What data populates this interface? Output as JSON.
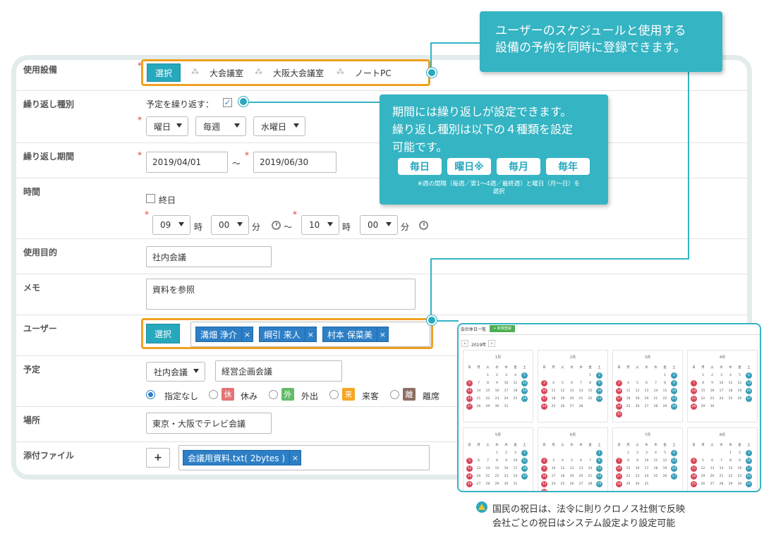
{
  "form": {
    "facility": {
      "label": "使用設備",
      "select_label": "選択",
      "items": [
        "大会議室",
        "大阪大会議室",
        "ノートPC"
      ]
    },
    "repeat_type": {
      "label": "繰り返し種別",
      "repeat_label": "予定を繰り返す：",
      "checked_mark": "✓",
      "selects": [
        "曜日",
        "毎週",
        "水曜日"
      ]
    },
    "repeat_period": {
      "label": "繰り返し期間",
      "start": "2019/04/01",
      "tilde": "～",
      "end": "2019/06/30"
    },
    "time": {
      "label": "時間",
      "allday": "終日",
      "start_hour": "09",
      "hour_unit": "時",
      "start_min": "00",
      "min_unit": "分",
      "tilde": "～",
      "end_hour": "10",
      "end_min": "00"
    },
    "purpose": {
      "label": "使用目的",
      "value": "社内会議"
    },
    "memo": {
      "label": "メモ",
      "value": "資料を参照"
    },
    "user": {
      "label": "ユーザー",
      "select_label": "選択",
      "chips": [
        "溝畑 浄介",
        "綱引 来人",
        "村本 保菜美"
      ],
      "remove": "×"
    },
    "schedule": {
      "label": "予定",
      "type": "社内会議",
      "title": "経営企画会議",
      "options": [
        {
          "text": "指定なし",
          "badge": "",
          "color": ""
        },
        {
          "text": "休み",
          "badge": "休",
          "color": "#e57373"
        },
        {
          "text": "外出",
          "badge": "外",
          "color": "#66bb6a"
        },
        {
          "text": "来客",
          "badge": "来",
          "color": "#f5a623"
        },
        {
          "text": "離席",
          "badge": "離",
          "color": "#8d6e63"
        }
      ]
    },
    "place": {
      "label": "場所",
      "value": "東京・大阪でテレビ会議"
    },
    "attach": {
      "label": "添付ファイル",
      "add": "+",
      "file": "会議用資料.txt( 2bytes )",
      "remove": "×"
    }
  },
  "callout1": {
    "line1": "ユーザーのスケジュールと使用する",
    "line2": "設備の予約を同時に登録できます。"
  },
  "callout2": {
    "line1": "期間には繰り返しが設定できます。",
    "line2": "繰り返し種別は以下の４種類を設定",
    "line3": "可能です。",
    "pills": [
      "毎日",
      "曜日※",
      "毎月",
      "毎年"
    ],
    "note1": "※週の間隔（毎週／第1～4週／最終週）と曜日（月～日）を",
    "note2": "選択"
  },
  "calendar": {
    "header": "会社休日一覧",
    "new_button": "+ 新規登録",
    "prev": "‹",
    "year": "2019年",
    "next": "›",
    "weekdays": [
      "日",
      "月",
      "火",
      "水",
      "木",
      "金",
      "土"
    ],
    "months": [
      "1月",
      "2月",
      "3月",
      "4月",
      "5月",
      "6月",
      "7月",
      "8月"
    ]
  },
  "note": {
    "line1": "国民の祝日は、法令に則りクロノス社側で反映",
    "line2": "会社ごとの祝日はシステム設定より設定可能"
  },
  "colors": {
    "accent": "#35b4c3",
    "highlight": "#f0a020",
    "chip": "#2d7fc6",
    "holiday_red": "#d9475a",
    "holiday_yellow": "#f2c230",
    "weekend_teal": "#3a9db5"
  }
}
